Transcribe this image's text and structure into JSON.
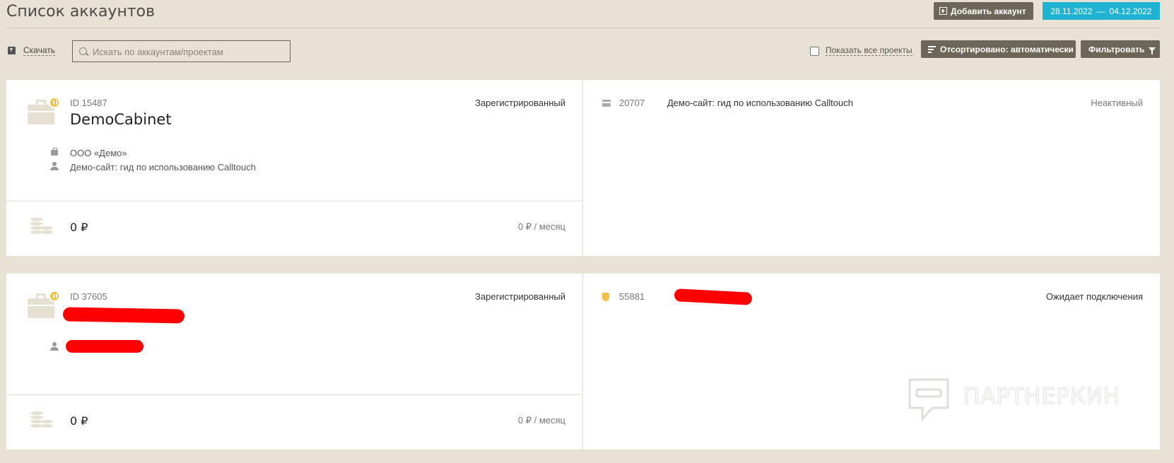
{
  "page": {
    "title": "Список аккаунтов",
    "add_account_label": "Добавить аккаунт",
    "date_from": "28.11.2022",
    "date_separator": "—",
    "date_to": "04.12.2022"
  },
  "toolbar": {
    "download_label": "Скачать",
    "search_placeholder": "Искать по аккаунтам/проектам",
    "show_all_label": "Показать все проекты",
    "sort_label": "Отсортировано: автоматически",
    "filter_label": "Фильтровать"
  },
  "accounts": [
    {
      "id_label": "ID 15487",
      "name": "DemoCabinet",
      "status": "Зарегистрированный",
      "organization": "ООО «Демо»",
      "contact": "Демо-сайт: гид по использованию Calltouch",
      "balance": "0 ₽",
      "per_month": "0 ₽ / месяц",
      "project": {
        "id": "20707",
        "name": "Демо-сайт: гид по использованию Calltouch",
        "status": "Неактивный",
        "status_color": "#777777"
      }
    },
    {
      "id_label": "ID 37605",
      "name": "",
      "status": "Зарегистрированный",
      "contact": "",
      "balance": "0 ₽",
      "per_month": "0 ₽ / месяц",
      "project": {
        "id": "55881",
        "name": "",
        "status": "Ожидает подключения",
        "status_color": "#333333"
      }
    }
  ],
  "watermark": {
    "text": "ПАРТНЕРКИН"
  },
  "colors": {
    "background": "#e8e2d4",
    "button_dark": "#6e6559",
    "date_accent": "#1fb3d3",
    "pause_badge": "#efc043",
    "redaction": "#ff0000"
  }
}
